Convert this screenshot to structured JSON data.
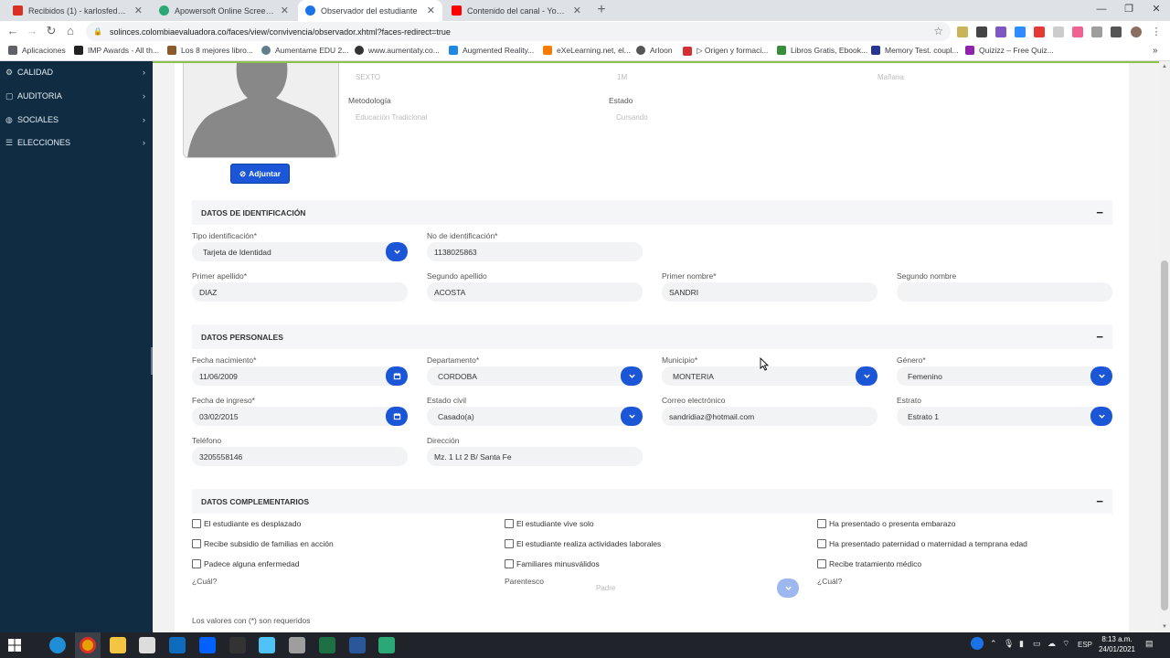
{
  "browser": {
    "tabs": [
      {
        "title": "Recibidos (1) - karlosfederiko@g",
        "color": "#d93025"
      },
      {
        "title": "Apowersoft Online Screen Recor",
        "color": "#2aa876"
      },
      {
        "title": "Observador del estudiante",
        "color": "#1a73e8"
      },
      {
        "title": "Contenido del canal - YouTube S",
        "color": "#ff0000"
      }
    ],
    "new_tab": "+",
    "url": "solinces.colombiaevaluadora.co/faces/view/convivencia/observador.xhtml?faces-redirect=true",
    "bookmarks": [
      {
        "label": "Aplicaciones",
        "color": "#5f6368"
      },
      {
        "label": "IMP Awards - All th...",
        "color": "#222222"
      },
      {
        "label": "Los 8 mejores libro...",
        "color": "#8b5a2b"
      },
      {
        "label": "Aumentame EDU 2...",
        "color": "#607d8b"
      },
      {
        "label": "www.aumentaty.co...",
        "color": "#333333"
      },
      {
        "label": "Augmented Reality...",
        "color": "#1e88e5"
      },
      {
        "label": "eXeLearning.net, el...",
        "color": "#f57c00"
      },
      {
        "label": "Arloon",
        "color": "#555555"
      },
      {
        "label": "▷ Origen y formaci...",
        "color": "#d32f2f"
      },
      {
        "label": "Libros Gratis, Ebook...",
        "color": "#388e3c"
      },
      {
        "label": "Memory Test. coupl...",
        "color": "#283593"
      },
      {
        "label": "Quizizz – Free Quiz...",
        "color": "#8e24aa"
      }
    ]
  },
  "sidebar": {
    "items": [
      {
        "label": "CALIDAD",
        "icon": "gear-icon"
      },
      {
        "label": "AUDITORIA",
        "icon": "doc-icon"
      },
      {
        "label": "SOCIALES",
        "icon": "globe-icon"
      },
      {
        "label": "ELECCIONES",
        "icon": "list-icon"
      }
    ]
  },
  "student_summary": {
    "grade_value": "SEXTO",
    "group_value": "1M",
    "shift_value": "Mañana",
    "methodology_label": "Metodología",
    "methodology_value": "Educación Tradicional",
    "status_label": "Estado",
    "status_value": "Cursando",
    "attach_button": "Adjuntar"
  },
  "identificacion": {
    "title": "DATOS DE IDENTIFICACIÓN",
    "tipo_label": "Tipo identificación*",
    "tipo_value": "Tarjeta de Identidad",
    "numero_label": "No de identificación*",
    "numero_value": "1138025863",
    "primer_apellido_label": "Primer apellido*",
    "primer_apellido_value": "DIAZ",
    "segundo_apellido_label": "Segundo apellido",
    "segundo_apellido_value": "ACOSTA",
    "primer_nombre_label": "Primer nombre*",
    "primer_nombre_value": "SANDRI",
    "segundo_nombre_label": "Segundo nombre",
    "segundo_nombre_value": ""
  },
  "personales": {
    "title": "DATOS PERSONALES",
    "fecha_nac_label": "Fecha nacimiento*",
    "fecha_nac_value": "11/06/2009",
    "departamento_label": "Departamento*",
    "departamento_value": "CORDOBA",
    "municipio_label": "Municipio*",
    "municipio_value": "MONTERIA",
    "genero_label": "Género*",
    "genero_value": "Femenino",
    "fecha_ingreso_label": "Fecha de ingreso*",
    "fecha_ingreso_value": "03/02/2015",
    "estado_civil_label": "Estado civil",
    "estado_civil_value": "Casado(a)",
    "correo_label": "Correo electrónico",
    "correo_value": "sandridiaz@hotmail.com",
    "estrato_label": "Estrato",
    "estrato_value": "Estrato 1",
    "telefono_label": "Teléfono",
    "telefono_value": "3205558146",
    "direccion_label": "Dirección",
    "direccion_value": "Mz. 1 Lt 2 B/ Santa Fe"
  },
  "complementarios": {
    "title": "DATOS COMPLEMENTARIOS",
    "checks": [
      "El estudiante es desplazado",
      "El estudiante vive solo",
      "Ha presentado o presenta embarazo",
      "Recibe subsidio de familias en acción",
      "El estudiante realiza actividades laborales",
      "Ha presentado paternidad o maternidad a temprana edad",
      "Padece alguna enfermedad",
      "Familiares minusválidos",
      "Recibe tratamiento médico"
    ],
    "cual_label_1": "¿Cuál?",
    "parentesco_label": "Parentesco",
    "parentesco_placeholder": "Padre",
    "cual_label_2": "¿Cuál?"
  },
  "footer_note": "Los valores con (*) son requeridos",
  "taskbar": {
    "lang": "ESP",
    "time": "8:13 a.m.",
    "date": "24/01/2021"
  },
  "colors": {
    "accent_blue": "#1a56d6",
    "sidebar_bg": "#0f2c42",
    "top_line": "#8bc34a"
  }
}
